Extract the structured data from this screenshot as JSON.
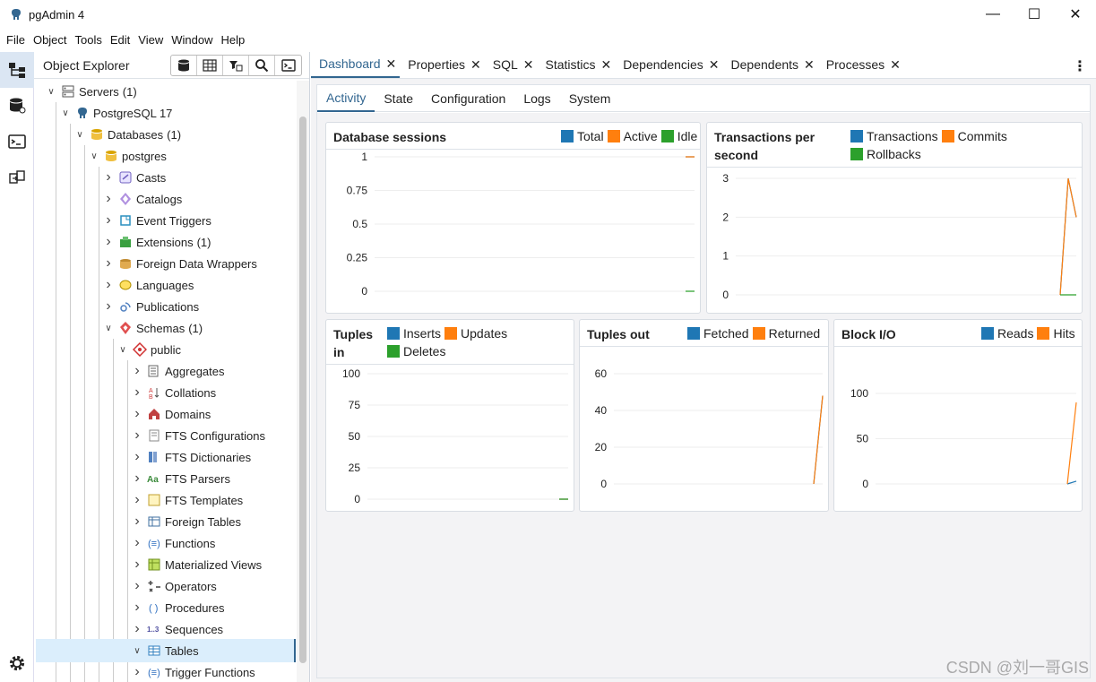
{
  "window": {
    "title": "pgAdmin 4",
    "minimize": "—",
    "maximize": "☐",
    "close": "✕"
  },
  "menu": [
    "File",
    "Object",
    "Tools",
    "Edit",
    "View",
    "Window",
    "Help"
  ],
  "explorer": {
    "title": "Object Explorer",
    "tree": [
      {
        "label": "Servers",
        "count": "(1)",
        "level": 0,
        "expanded": true,
        "icon": "servers-icon"
      },
      {
        "label": "PostgreSQL 17",
        "count": "",
        "level": 1,
        "expanded": true,
        "icon": "elephant-icon"
      },
      {
        "label": "Databases",
        "count": "(1)",
        "level": 2,
        "expanded": true,
        "icon": "databases-icon"
      },
      {
        "label": "postgres",
        "count": "",
        "level": 3,
        "expanded": true,
        "icon": "database-icon"
      },
      {
        "label": "Casts",
        "count": "",
        "level": 4,
        "expanded": false,
        "icon": "casts-icon"
      },
      {
        "label": "Catalogs",
        "count": "",
        "level": 4,
        "expanded": false,
        "icon": "catalogs-icon"
      },
      {
        "label": "Event Triggers",
        "count": "",
        "level": 4,
        "expanded": false,
        "icon": "event-triggers-icon"
      },
      {
        "label": "Extensions",
        "count": "(1)",
        "level": 4,
        "expanded": false,
        "icon": "extensions-icon"
      },
      {
        "label": "Foreign Data Wrappers",
        "count": "",
        "level": 4,
        "expanded": false,
        "icon": "fdw-icon"
      },
      {
        "label": "Languages",
        "count": "",
        "level": 4,
        "expanded": false,
        "icon": "languages-icon"
      },
      {
        "label": "Publications",
        "count": "",
        "level": 4,
        "expanded": false,
        "icon": "publications-icon"
      },
      {
        "label": "Schemas",
        "count": "(1)",
        "level": 4,
        "expanded": true,
        "icon": "schemas-icon"
      },
      {
        "label": "public",
        "count": "",
        "level": 5,
        "expanded": true,
        "icon": "schema-icon"
      },
      {
        "label": "Aggregates",
        "count": "",
        "level": 6,
        "expanded": false,
        "icon": "aggregates-icon"
      },
      {
        "label": "Collations",
        "count": "",
        "level": 6,
        "expanded": false,
        "icon": "collations-icon"
      },
      {
        "label": "Domains",
        "count": "",
        "level": 6,
        "expanded": false,
        "icon": "domains-icon"
      },
      {
        "label": "FTS Configurations",
        "count": "",
        "level": 6,
        "expanded": false,
        "icon": "fts-configurations-icon"
      },
      {
        "label": "FTS Dictionaries",
        "count": "",
        "level": 6,
        "expanded": false,
        "icon": "fts-dictionaries-icon"
      },
      {
        "label": "FTS Parsers",
        "count": "",
        "level": 6,
        "expanded": false,
        "icon": "fts-parsers-icon"
      },
      {
        "label": "FTS Templates",
        "count": "",
        "level": 6,
        "expanded": false,
        "icon": "fts-templates-icon"
      },
      {
        "label": "Foreign Tables",
        "count": "",
        "level": 6,
        "expanded": false,
        "icon": "foreign-tables-icon"
      },
      {
        "label": "Functions",
        "count": "",
        "level": 6,
        "expanded": false,
        "icon": "functions-icon"
      },
      {
        "label": "Materialized Views",
        "count": "",
        "level": 6,
        "expanded": false,
        "icon": "materialized-views-icon"
      },
      {
        "label": "Operators",
        "count": "",
        "level": 6,
        "expanded": false,
        "icon": "operators-icon"
      },
      {
        "label": "Procedures",
        "count": "",
        "level": 6,
        "expanded": false,
        "icon": "procedures-icon"
      },
      {
        "label": "Sequences",
        "count": "",
        "level": 6,
        "expanded": false,
        "icon": "sequences-icon"
      },
      {
        "label": "Tables",
        "count": "",
        "level": 6,
        "expanded": true,
        "icon": "tables-icon",
        "selected": true
      },
      {
        "label": "Trigger Functions",
        "count": "",
        "level": 6,
        "expanded": false,
        "icon": "trigger-functions-icon"
      }
    ]
  },
  "tabs": [
    {
      "label": "Dashboard",
      "active": true
    },
    {
      "label": "Properties",
      "active": false
    },
    {
      "label": "SQL",
      "active": false
    },
    {
      "label": "Statistics",
      "active": false
    },
    {
      "label": "Dependencies",
      "active": false
    },
    {
      "label": "Dependents",
      "active": false
    },
    {
      "label": "Processes",
      "active": false
    }
  ],
  "subtabs": [
    {
      "label": "Activity",
      "active": true
    },
    {
      "label": "State",
      "active": false
    },
    {
      "label": "Configuration",
      "active": false
    },
    {
      "label": "Logs",
      "active": false
    },
    {
      "label": "System",
      "active": false
    }
  ],
  "colors": {
    "blue": "#1f77b4",
    "orange": "#ff7f0e",
    "green": "#2ca02c",
    "accent": "#326690"
  },
  "watermark": "CSDN @刘一哥GIS",
  "chart_data": [
    {
      "type": "line",
      "title": "Database sessions",
      "ylim": [
        0,
        1
      ],
      "yticks": [
        "1",
        "0.75",
        "0.5",
        "0.25",
        "0"
      ],
      "series": [
        {
          "name": "Total",
          "values": [
            1,
            1
          ]
        },
        {
          "name": "Active",
          "values": [
            1,
            1
          ]
        },
        {
          "name": "Idle",
          "values": [
            0,
            0
          ]
        }
      ]
    },
    {
      "type": "line",
      "title": "Transactions per second",
      "ylim": [
        0,
        3
      ],
      "yticks": [
        "3",
        "2",
        "1",
        "0"
      ],
      "series": [
        {
          "name": "Transactions",
          "values": [
            0,
            3,
            2
          ]
        },
        {
          "name": "Commits",
          "values": [
            0,
            3,
            2
          ]
        },
        {
          "name": "Rollbacks",
          "values": [
            0,
            0,
            0
          ]
        }
      ]
    },
    {
      "type": "line",
      "title": "Tuples in",
      "ylim": [
        0,
        100
      ],
      "yticks": [
        "100",
        "75",
        "50",
        "25",
        "0"
      ],
      "series": [
        {
          "name": "Inserts",
          "values": [
            0,
            0
          ]
        },
        {
          "name": "Updates",
          "values": [
            0,
            0
          ]
        },
        {
          "name": "Deletes",
          "values": [
            0,
            0
          ]
        }
      ]
    },
    {
      "type": "line",
      "title": "Tuples out",
      "ylim": [
        0,
        60
      ],
      "yticks": [
        "60",
        "40",
        "20",
        "0"
      ],
      "series": [
        {
          "name": "Fetched",
          "values": [
            0,
            48
          ]
        },
        {
          "name": "Returned",
          "values": [
            0,
            48
          ]
        }
      ]
    },
    {
      "type": "line",
      "title": "Block I/O",
      "ylim": [
        0,
        100
      ],
      "yticks": [
        "100",
        "50",
        "0"
      ],
      "series": [
        {
          "name": "Reads",
          "values": [
            0,
            3
          ]
        },
        {
          "name": "Hits",
          "values": [
            0,
            90
          ]
        }
      ]
    }
  ]
}
